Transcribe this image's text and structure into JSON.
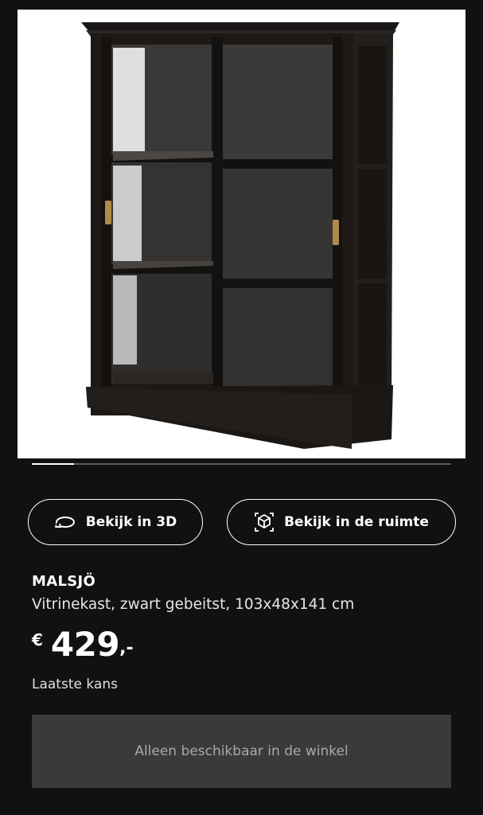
{
  "carousel": {
    "image_name": "malsjo-cabinet-image",
    "slide_progress": 0.1
  },
  "actions": {
    "view_3d_label": "Bekijk in 3D",
    "view_room_label": "Bekijk in de ruimte",
    "view_3d_icon": "rotate-3d-icon",
    "view_room_icon": "ar-cube-icon"
  },
  "product": {
    "name": "MALSJÖ",
    "description": "Vitrinekast, zwart gebeitst, 103x48x141 cm",
    "price": {
      "currency": "€",
      "integer": "429",
      "decimal": ",-"
    },
    "status": "Laatste kans",
    "availability": "Alleen beschikbaar in de winkel"
  },
  "colors": {
    "background": "#111111",
    "availability_box": "#3a3a3a",
    "text_primary": "#ffffff",
    "text_muted": "#a9a9a9"
  }
}
